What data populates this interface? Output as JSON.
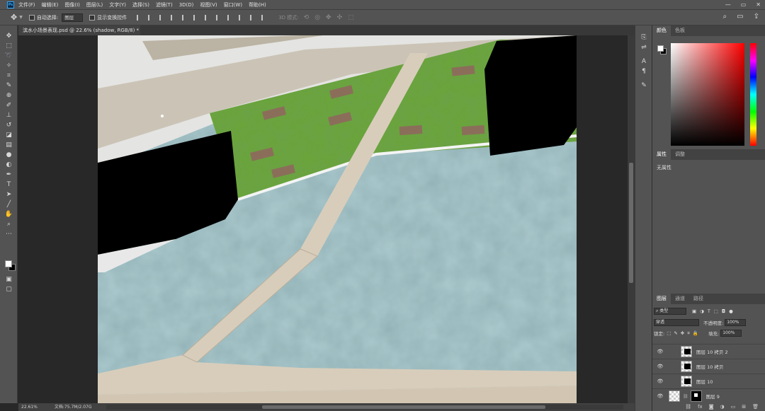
{
  "app": {
    "logo": "Ps",
    "menu": [
      "文件(F)",
      "编辑(E)",
      "图像(I)",
      "图层(L)",
      "文字(Y)",
      "选择(S)",
      "滤镜(T)",
      "3D(D)",
      "视图(V)",
      "窗口(W)",
      "帮助(H)"
    ],
    "window_controls": [
      "—",
      "▭",
      "✕"
    ]
  },
  "options_bar": {
    "auto_select_label": "自动选择:",
    "auto_select_value": "图层",
    "show_transform_label": "显示变换控件",
    "mode3d_label": "3D 模式:",
    "align_icon_count": 12,
    "right_icons": [
      "search-icon",
      "workspace-icon",
      "share-icon"
    ]
  },
  "document": {
    "tab_title": "滨水小场景表现.psd @ 22.6% (shadow, RGB/8) *",
    "close": "×"
  },
  "status": {
    "zoom": "22.61%",
    "doc_size": "文档:75.7M/2.07G"
  },
  "tools": [
    "move-tool-icon",
    "marquee-tool-icon",
    "lasso-tool-icon",
    "magic-wand-icon",
    "crop-tool-icon",
    "eyedropper-icon",
    "healing-brush-icon",
    "brush-tool-icon",
    "stamp-tool-icon",
    "history-brush-icon",
    "eraser-icon",
    "gradient-tool-icon",
    "blur-tool-icon",
    "dodge-tool-icon",
    "pen-tool-icon",
    "type-tool-icon",
    "path-select-icon",
    "line-tool-icon",
    "hand-tool-icon",
    "zoom-tool-icon",
    "more-tools-icon"
  ],
  "panels": {
    "color_tabs": [
      "颜色",
      "色板"
    ],
    "properties_tabs": [
      "属性",
      "调整"
    ],
    "no_properties": "无属性",
    "layers_tabs": [
      "图层",
      "通道",
      "路径"
    ],
    "filter_kind": "类型",
    "blend_mode": "穿透",
    "opacity_label": "不透明度:",
    "opacity_value": "100%",
    "lock_label": "锁定:",
    "fill_label": "填充:",
    "fill_value": "100%",
    "layers": [
      {
        "name": "图层 10 拷贝 2",
        "visible": true
      },
      {
        "name": "图层 10 拷贝",
        "visible": true
      },
      {
        "name": "图层 10",
        "visible": true
      },
      {
        "name": "图层 9",
        "visible": true
      }
    ]
  },
  "colors": {
    "ui_dark": "#282828",
    "ui_panel": "#535353",
    "lawn": "#6aa43a",
    "water": "#a9c8cc",
    "paving": "#d8cdbb",
    "building": "#000000"
  }
}
